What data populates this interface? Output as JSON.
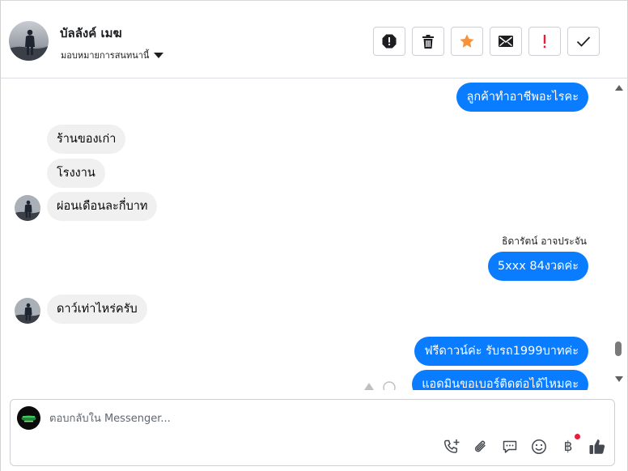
{
  "header": {
    "contact_name": "บัลลังค์ เมฆ",
    "assign_label": "มอบหมายการสนทนานี้"
  },
  "conversation": {
    "messages": [
      {
        "text": "ลูกค้าทำอาชีพอะไรคะ",
        "direction": "out"
      },
      {
        "text": "ร้านของเก่า",
        "direction": "in"
      },
      {
        "text": "โรงงาน",
        "direction": "in"
      },
      {
        "text": "ผ่อนเดือนละกี่บาท",
        "direction": "in"
      },
      {
        "text": "5xxx 84งวดค่ะ",
        "direction": "out",
        "sender": "ธิดารัตน์ อาจประจัน"
      },
      {
        "text": "ดาว์เท่าไหร่ครับ",
        "direction": "in"
      },
      {
        "text": "ฟรีดาวน์ค่ะ รับรถ1999บาทค่ะ",
        "direction": "out"
      },
      {
        "text": "แอดมินขอเบอร์ติดต่อได้ไหมคะ",
        "direction": "out"
      }
    ]
  },
  "composer": {
    "placeholder": "ตอบกลับใน Messenger..."
  },
  "colors": {
    "outgoing_bubble": "#0a7cff",
    "incoming_bubble": "#f0f0f0",
    "star": "#f7923b",
    "notification_dot": "#e41e3f",
    "alert": "#e41e3f"
  },
  "icons": {
    "actions": [
      "spam-icon",
      "trash-icon",
      "star-icon",
      "mail-icon",
      "follow-up-icon",
      "done-check-icon"
    ],
    "composer_tools": [
      "call-add-icon",
      "paperclip-icon",
      "saved-reply-icon",
      "emoji-icon",
      "baht-payment-icon",
      "like-icon"
    ]
  }
}
